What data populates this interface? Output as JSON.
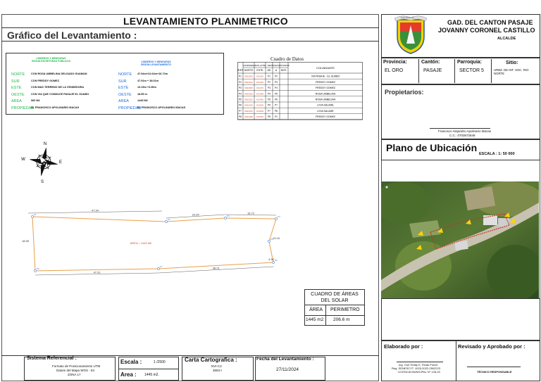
{
  "header": {
    "title": "LEVANTAMIENTO PLANIMETRICO",
    "subtitle": "Gráfico del Levantamiento :"
  },
  "institution": {
    "name": "GAD.   DEL CANTON PASAJE",
    "mayor": "JOVANNY CORONEL CASTILLO",
    "role": "ALCALDE",
    "seal_text": "GAD PASAJE"
  },
  "location": {
    "provincia_label": "Provincia:",
    "provincia": "EL ORO",
    "canton_label": "Cantón:",
    "canton": "PASAJE",
    "parroquia_label": "Parroquia:",
    "parroquia": "SECTOR 5",
    "sitio_label": "Sitio:",
    "sitio": "URBZ. DE INT. SOC. RIO NORTE"
  },
  "owners": {
    "label": "Propietarios:",
    "name": "Francisco Alejandro Apolinario Macas",
    "ci": "C.C.: 0703572649"
  },
  "ubicacion": {
    "title": "Plano de Ubicación",
    "escala": "ESCALA  :   1: 50 000"
  },
  "linderos": {
    "head_left": "LINDEROS Y MENSURAS\nSEGÚN ESCRITURAS PUBLICAS",
    "head_right": "LINDEROS Y MENSURAS\nSEGÚN LEVANTAMIENTO",
    "rows": [
      {
        "key": "NORTE",
        "left": "CON ROSA UMBELINA DELGADO GUAMAN",
        "rkey": "NORTE",
        "right": "47.94m+22.64m+16.72m"
      },
      {
        "key": "SUR",
        "left": "CON FREDDY GOMEZ",
        "rkey": "SUR",
        "right": "47.91m + 38.01m"
      },
      {
        "key": "ESTE",
        "left": "CON MAS TERRENO DE LA VENDEDORA",
        "rkey": "ESTE",
        "right": "13.15m +4.90m"
      },
      {
        "key": "OESTE",
        "left": "CON VIA QUE CONDUCE PASAJE EL GUABO",
        "rkey": "OESTE",
        "right": "18.55 m"
      },
      {
        "key": "AREA",
        "left": "960 M2",
        "rkey": "AREA",
        "right": "1445 M2"
      },
      {
        "key": "PROPIEDAD",
        "left": "Sr. FRANCISCO APOLINARIO MACAS",
        "rkey": "PROPIEDAD",
        "right": "Sr. FRANCISCO APOLINARIO MACAS"
      }
    ]
  },
  "cuadro_datos": {
    "title": "Cuadro  de  Datos",
    "headers": [
      "VERT.",
      "NORTE",
      "ESTE",
      "DE",
      "A",
      "DIST.",
      "COLINDANTE"
    ],
    "group_coord": "COORDENADAS (UTM)",
    "group_vert": "VERTICES",
    "group_dist": "DISTANCIA",
    "rows": [
      {
        "v": "P1",
        "n": "9632500",
        "e": "631420",
        "de": "P1",
        "a": "P2",
        "d": "",
        "c": "VIA PASAJE - EL GUABO"
      },
      {
        "v": "P2",
        "n": "9632510",
        "e": "631425",
        "de": "P2",
        "a": "P3",
        "d": "",
        "c": "FREDDY GOMEZ"
      },
      {
        "v": "P3",
        "n": "9632505",
        "e": "631470",
        "de": "P3",
        "a": "P4",
        "d": "",
        "c": "FREDDY GOMEZ"
      },
      {
        "v": "P4",
        "n": "9632530",
        "e": "631468",
        "de": "P4",
        "a": "P5",
        "d": "",
        "c": "ROSA UMBELINA"
      },
      {
        "v": "P5",
        "n": "9632532",
        "e": "631490",
        "de": "P5",
        "a": "P6",
        "d": "",
        "c": "ROSA UMBELINA"
      },
      {
        "v": "P6",
        "n": "9632520",
        "e": "631505",
        "de": "P6",
        "a": "P7",
        "d": "",
        "c": "LIVIA SALAME"
      },
      {
        "v": "P7",
        "n": "9632515",
        "e": "631508",
        "de": "P7",
        "a": "P8",
        "d": "",
        "c": "LIVIA SALAME"
      },
      {
        "v": "P8",
        "n": "9632498",
        "e": "631505",
        "de": "P8",
        "a": "P1",
        "d": "",
        "c": "FREDDY GOMEZ"
      }
    ]
  },
  "plano": {
    "area_label": "AREA = 1445 M2",
    "dims": {
      "north1": "47.94",
      "north2": "22.64",
      "north3": "16.72",
      "east1": "13.15",
      "east2": "4.90",
      "south1": "47.91",
      "south2": "38.01",
      "west": "18.55"
    },
    "vertices": [
      "P1",
      "P2",
      "P3",
      "P4",
      "P5",
      "P6",
      "P7",
      "P8"
    ],
    "compass": {
      "n": "N",
      "s": "S",
      "e": "E",
      "w": "W"
    }
  },
  "areas": {
    "title": "CUADRO DE ÁREAS\nDEL SOLAR",
    "h1": "ÁREA",
    "h2": "PERIMETRO",
    "v1": "1445 m2",
    "v2": "206.6 m"
  },
  "footer": {
    "sist_label": "Sistema Referencial :",
    "sist_l1": "Formato de Posicionamiento UTM",
    "sist_l2": "Datum del Mapa WGS - 84",
    "sist_l3": "ZONA 17",
    "escala_label": "Escala :",
    "escala": "1 /2500",
    "area_label": "Area :",
    "area": "1445 m2.",
    "carta_label": "Carta Cartografica :",
    "carta_l1": "NVI-C2",
    "carta_l2": "3663-I",
    "fecha_label": "Fecha del Levantamiento :",
    "fecha": "27/11/2024",
    "elab_label": "Elaborado por :",
    "elab_l1": "Ing. Civil Teddy E. Rivas Ponce",
    "elab_l2": "Reg. SENESCYT: 1025-2022-2502223",
    "elab_l3": "LICENCIA MUNICIPAL N° 128-20",
    "rev_label": "Revisado y Aprobado por :",
    "rev_l1": "TÉCNICO RESPONSABLE"
  },
  "colors": {
    "accent": "#d94a1f",
    "lindero_green": "#1fb84a",
    "lindero_blue": "#1f6fe0",
    "plot_line": "#e8a04a",
    "title_red": "#c0392b"
  }
}
